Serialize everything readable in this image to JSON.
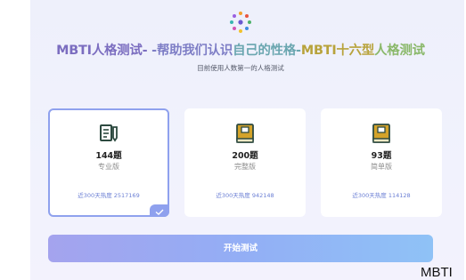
{
  "header": {
    "title_parts": [
      "MBTI人格测试-",
      " -帮助我们认识",
      "自己的性格-",
      "MBTI十六型",
      "人格测试"
    ],
    "subtitle": "目前使用人数第一的人格测试"
  },
  "logo_icon": "colorful-dots-ring-icon",
  "cards": [
    {
      "count": "144题",
      "edition": "专业版",
      "heat": "近300天热度 2517169",
      "icon": "document-pen-icon",
      "selected": true
    },
    {
      "count": "200题",
      "edition": "完整版",
      "heat": "近300天热度 942148",
      "icon": "book-icon",
      "selected": false
    },
    {
      "count": "93题",
      "edition": "简单版",
      "heat": "近300天热度 114128",
      "icon": "book-icon",
      "selected": false
    }
  ],
  "start_button": "开始测试",
  "corner_text": "MBTI",
  "colors": {
    "accent": "#8fa1ee",
    "book": "#d4a32a",
    "icon_dark": "#2d4a40"
  }
}
